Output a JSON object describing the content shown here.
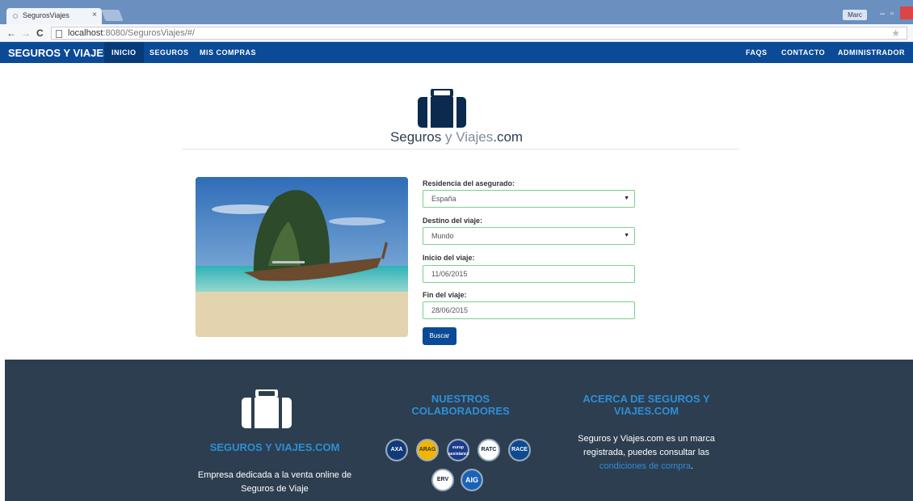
{
  "browser": {
    "tab_title": "SegurosViajes",
    "tab_close": "×",
    "user": "Marc",
    "url_host": "localhost",
    "url_rest": ":8080/SegurosViajes/#/",
    "back_icon": "←",
    "forward_icon": "→",
    "reload_icon": "C",
    "star_icon": "★"
  },
  "navbar": {
    "brand": "SEGUROS Y VIAJES",
    "left_links": [
      "INICIO",
      "SEGUROS",
      "MIS COMPRAS"
    ],
    "right_links": [
      "FAQS",
      "CONTACTO",
      "ADMINISTRADOR"
    ],
    "active": "INICIO"
  },
  "hero": {
    "logo_part1": "Seguros",
    "logo_part2": " y Viajes",
    "logo_part3": ".com"
  },
  "form": {
    "residencia_label": "Residencia del asegurado:",
    "residencia_value": "España",
    "destino_label": "Destino del viaje:",
    "destino_value": "Mundo",
    "inicio_label": "Inicio del viaje:",
    "inicio_value": "11/06/2015",
    "fin_label": "Fin del viaje:",
    "fin_value": "28/06/2015",
    "submit": "Buscar"
  },
  "footer": {
    "col1_title": "SEGUROS Y VIAJES.COM",
    "col1_text_line1": "Empresa dedicada a la venta online de",
    "col1_text_line2": "Seguros de Viaje",
    "col2_title_line1": "NUESTROS",
    "col2_title_line2": "COLABORADORES",
    "partners": [
      "AXA",
      "ARAG",
      "europ assistance",
      "RATC",
      "RACE",
      "ERV",
      "AIG"
    ],
    "col3_title_line1": "ACERCA DE SEGUROS Y",
    "col3_title_line2": "VIAJES.COM",
    "col3_text_line1": "Seguros y Viajes.com es un marca",
    "col3_text_line2": "registrada, puedes consultar las",
    "col3_link": "condiciones de compra",
    "col3_after": "."
  },
  "colors": {
    "navbar": "#0a4a96",
    "footer": "#2c3e50",
    "accent": "#2e8fd6"
  }
}
